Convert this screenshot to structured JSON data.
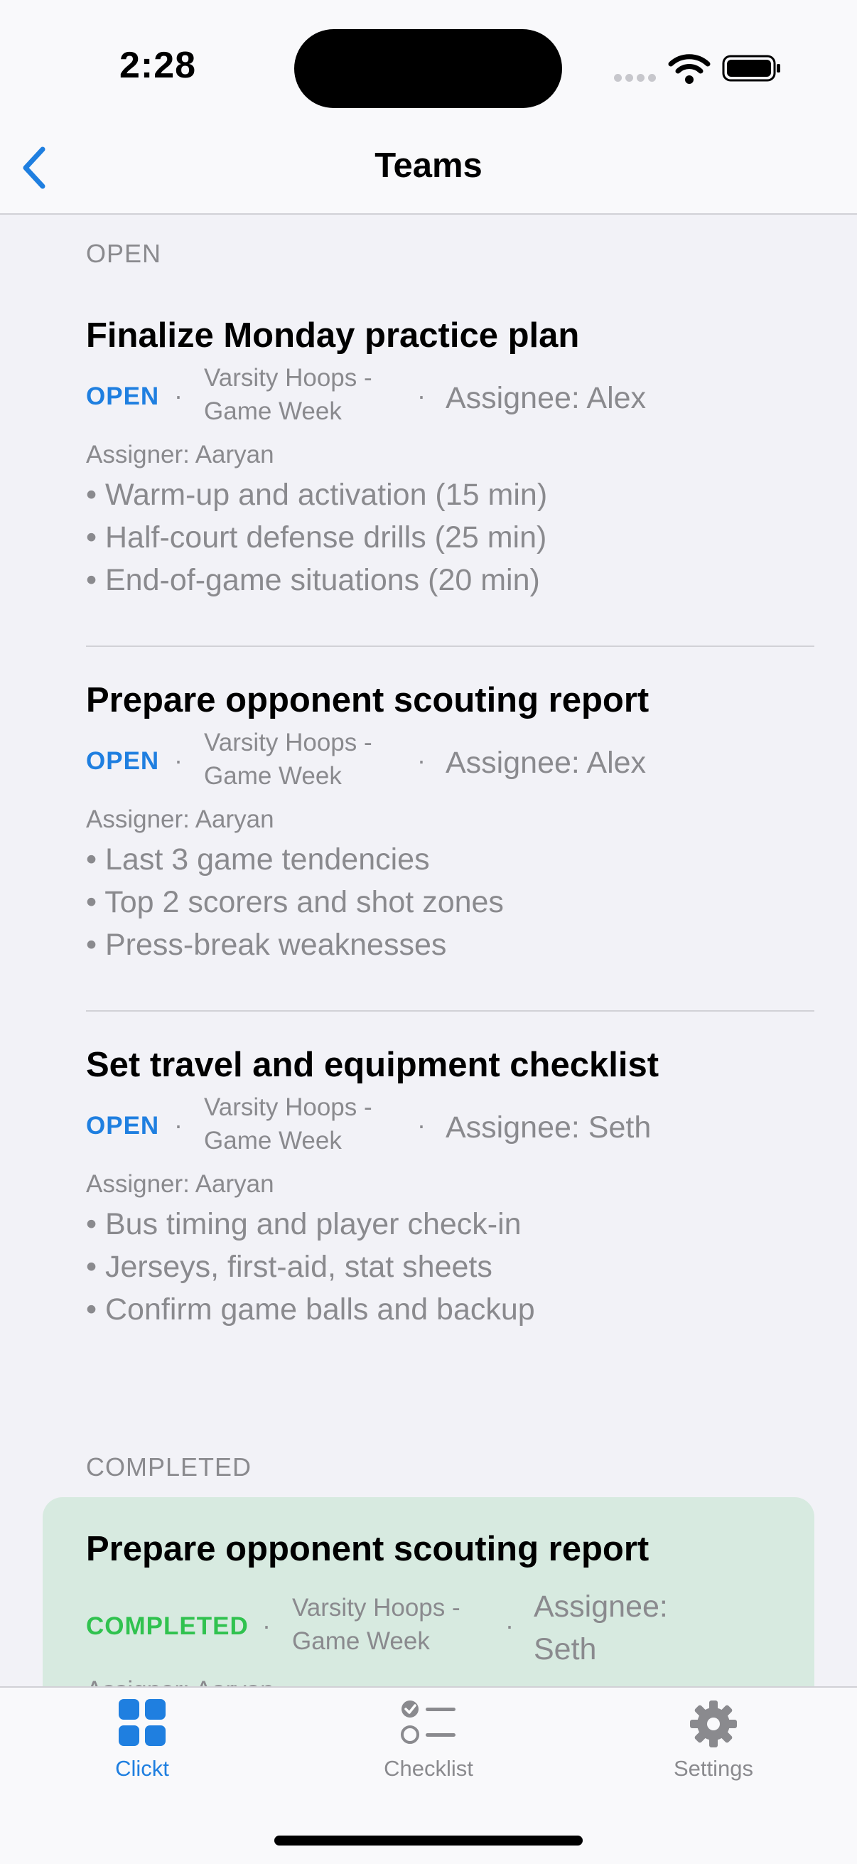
{
  "status_bar": {
    "time": "2:28"
  },
  "nav": {
    "title": "Teams"
  },
  "sections": {
    "open_header": "OPEN",
    "completed_header": "COMPLETED"
  },
  "open_tasks": [
    {
      "title": "Finalize Monday practice plan",
      "status": "OPEN",
      "team": "Varsity Hoops - Game Week",
      "assignee": "Assignee: Alex",
      "assigner": "Assigner: Aaryan",
      "notes": [
        "• Warm-up and activation (15 min)",
        "• Half-court defense drills (25 min)",
        "• End-of-game situations (20 min)"
      ]
    },
    {
      "title": "Prepare opponent scouting report",
      "status": "OPEN",
      "team": "Varsity Hoops - Game Week",
      "assignee": "Assignee: Alex",
      "assigner": "Assigner: Aaryan",
      "notes": [
        "• Last 3 game tendencies",
        "• Top 2 scorers and shot zones",
        "• Press-break weaknesses"
      ]
    },
    {
      "title": "Set travel and equipment checklist",
      "status": "OPEN",
      "team": "Varsity Hoops - Game Week",
      "assignee": "Assignee: Seth",
      "assigner": "Assigner: Aaryan",
      "notes": [
        "• Bus timing and player check-in",
        "• Jerseys, first-aid, stat sheets",
        "• Confirm game balls and backup"
      ]
    }
  ],
  "completed_tasks": [
    {
      "title": "Prepare opponent scouting report",
      "status": "COMPLETED",
      "team": "Varsity Hoops - Game Week",
      "assignee": "Assignee: Seth",
      "assigner": "Assigner: Aaryan"
    }
  ],
  "tabs": [
    {
      "label": "Clickt",
      "icon": "grid-icon",
      "active": true
    },
    {
      "label": "Checklist",
      "icon": "checklist-icon",
      "active": false
    },
    {
      "label": "Settings",
      "icon": "gear-icon",
      "active": false
    }
  ],
  "colors": {
    "accent": "#1f7fe0",
    "completed": "#30c24f",
    "completed_card_bg": "#d7eae0",
    "secondary_text": "#8a8a8e",
    "background": "#f2f2f7",
    "inactive_tab": "#8a8a8e"
  }
}
